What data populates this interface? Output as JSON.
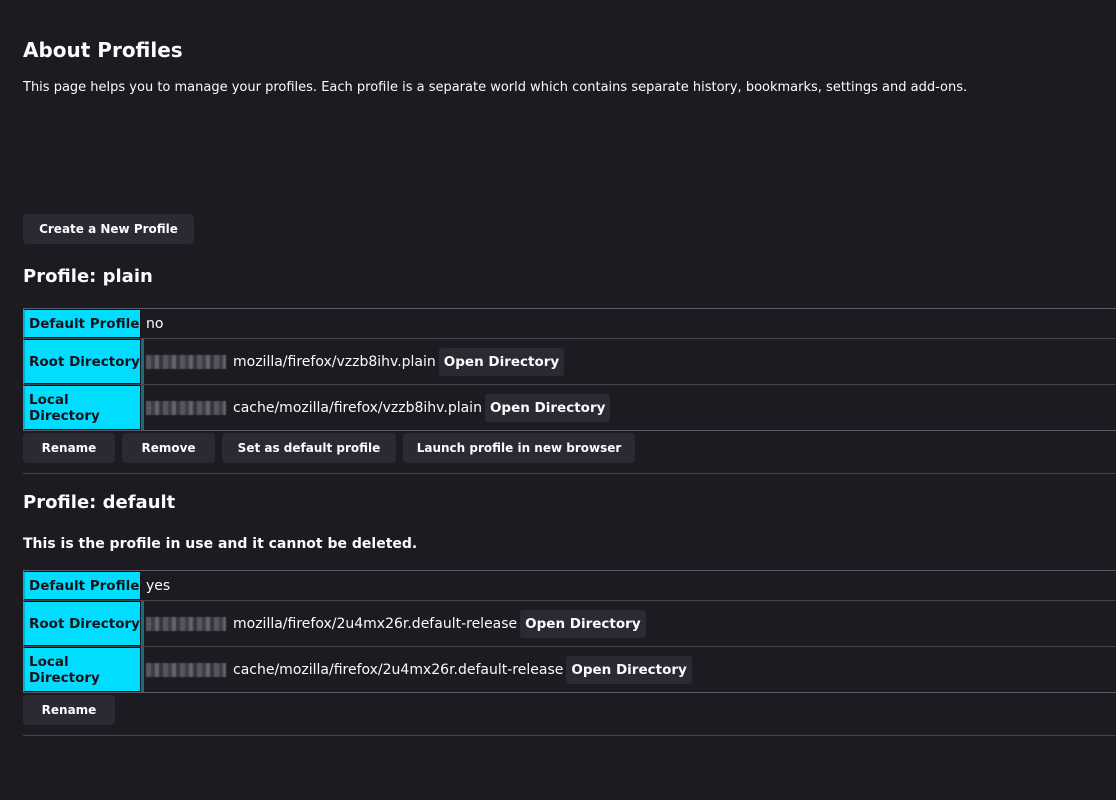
{
  "page": {
    "title": "About Profiles",
    "intro": "This page helps you to manage your profiles. Each profile is a separate world which contains separate history, bookmarks, settings and add-ons.",
    "create_button": "Create a New Profile"
  },
  "labels": {
    "default_profile": "Default Profile",
    "root_directory": "Root Directory",
    "local_directory": "Local Directory",
    "open_directory": "Open Directory"
  },
  "profiles": [
    {
      "heading": "Profile: plain",
      "default": "no",
      "root_dir": "mozilla/firefox/vzzb8ihv.plain",
      "local_dir": "cache/mozilla/firefox/vzzb8ihv.plain",
      "buttons": {
        "rename": "Rename",
        "remove": "Remove",
        "set_default": "Set as default profile",
        "launch": "Launch profile in new browser"
      }
    },
    {
      "heading": "Profile: default",
      "note": "This is the profile in use and it cannot be deleted.",
      "default": "yes",
      "root_dir": "mozilla/firefox/2u4mx26r.default-release",
      "local_dir": "cache/mozilla/firefox/2u4mx26r.default-release",
      "buttons": {
        "rename": "Rename"
      }
    }
  ],
  "colors": {
    "background": "#1c1b22",
    "key_cell": "#00ddff",
    "button": "#2b2a33"
  }
}
